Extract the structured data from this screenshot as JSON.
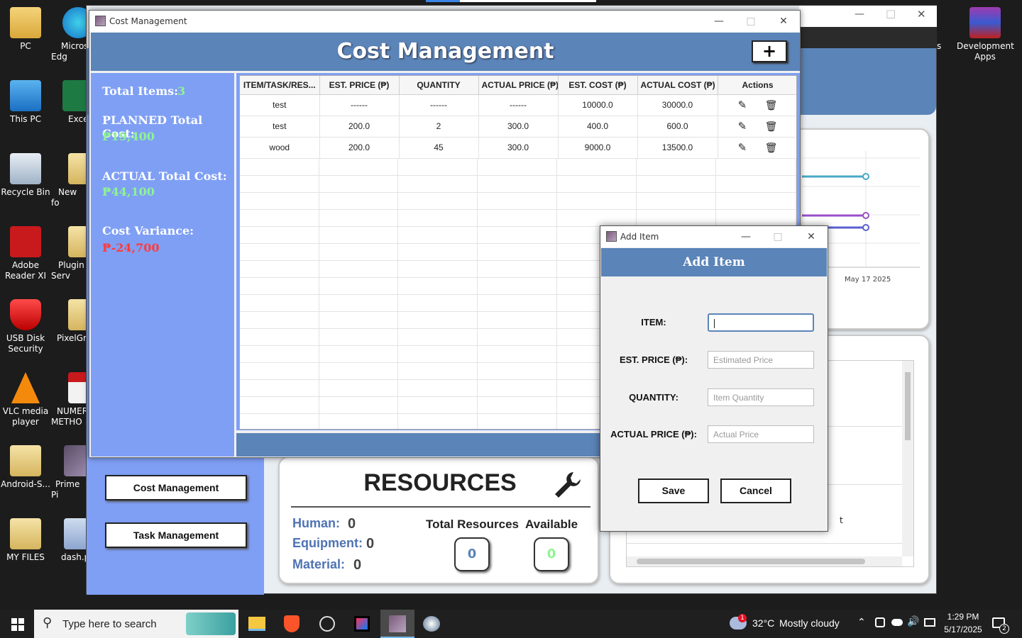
{
  "desktop": {
    "icons": [
      {
        "label": "PC"
      },
      {
        "label": "Micros Edg"
      },
      {
        "label": "This PC"
      },
      {
        "label": "Exce"
      },
      {
        "label": "Recycle Bin"
      },
      {
        "label": "New fo"
      },
      {
        "label": "Adobe Reader XI"
      },
      {
        "label": "Plugin Serv"
      },
      {
        "label": "USB Disk Security"
      },
      {
        "label": "PixelGro"
      },
      {
        "label": "VLC media player"
      },
      {
        "label": "NUMER METHO"
      },
      {
        "label": "Android-S..."
      },
      {
        "label": "Prime Pi"
      },
      {
        "label": "MY FILES"
      },
      {
        "label": "dash.p"
      },
      {
        "label": "Development Apps"
      },
      {
        "label": "s"
      }
    ]
  },
  "background_app": {
    "chart_date_label": "May 17 2025",
    "resources": {
      "title": "RESOURCES",
      "human_label": "Human:",
      "human_value": "0",
      "equipment_label": "Equipment:",
      "equipment_value": "0",
      "material_label": "Material:",
      "material_value": "0",
      "total_label": "Total Resources",
      "total_value": "0",
      "available_label": "Available",
      "available_value": "0"
    },
    "nav": {
      "cost_button": "Cost Management",
      "task_button": "Task Management"
    },
    "list_partial_text": "t"
  },
  "cost_window": {
    "title": "Cost Management",
    "header": "Cost Management",
    "add_button": "+",
    "summary": {
      "total_items_label": "Total Items:",
      "total_items_value": "3",
      "planned_label": "PLANNED Total Cost:",
      "planned_value": "₱19,400",
      "actual_label": "ACTUAL Total Cost:",
      "actual_value": "₱44,100",
      "variance_label": "Cost Variance:",
      "variance_value": "₱-24,700"
    },
    "table": {
      "columns": [
        "ITEM/TASK/RES...",
        "EST. PRICE (₱)",
        "QUANTITY",
        "ACTUAL PRICE (₱)",
        "EST. COST (₱)",
        "ACTUAL COST (₱)",
        "Actions"
      ],
      "rows": [
        [
          "test",
          "------",
          "------",
          "------",
          "10000.0",
          "30000.0"
        ],
        [
          "test",
          "200.0",
          "2",
          "300.0",
          "400.0",
          "600.0"
        ],
        [
          "wood",
          "200.0",
          "45",
          "300.0",
          "9000.0",
          "13500.0"
        ]
      ]
    }
  },
  "add_item_dialog": {
    "title": "Add Item",
    "header": "Add Item",
    "item_label": "ITEM:",
    "item_value": "",
    "est_price_label": "EST. PRICE (₱):",
    "est_price_placeholder": "Estimated Price",
    "quantity_label": "QUANTITY:",
    "quantity_placeholder": "Item Quantity",
    "actual_price_label": "ACTUAL PRICE (₱):",
    "actual_price_placeholder": "Actual Price",
    "save_label": "Save",
    "cancel_label": "Cancel"
  },
  "taskbar": {
    "search_placeholder": "Type here to search",
    "weather_temp": "32°C",
    "weather_text": "Mostly cloudy",
    "weather_badge": "1",
    "time": "1:29 PM",
    "date": "5/17/2025",
    "notification_count": "2"
  },
  "colors": {
    "header_blue": "#5b84b8",
    "panel_blue": "#7f9ff5",
    "green_value": "#8ef58e",
    "red_value": "#ff3b3b",
    "label_blue": "#4f73b3"
  }
}
